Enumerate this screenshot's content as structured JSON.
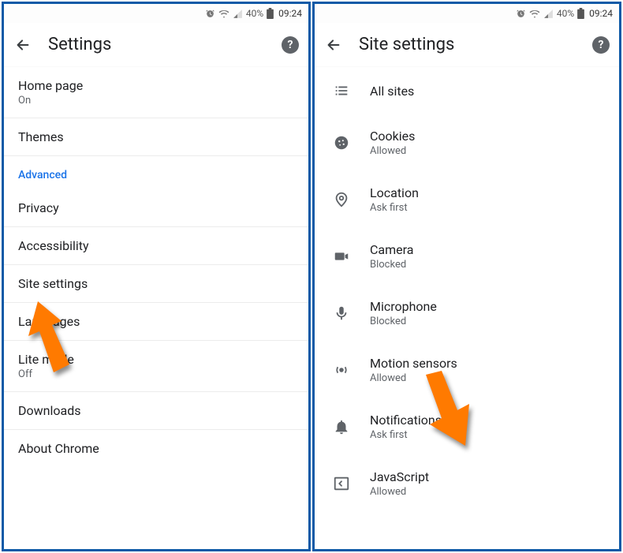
{
  "status": {
    "battery_pct": "40%",
    "time": "09:24"
  },
  "left": {
    "title": "Settings",
    "items": [
      {
        "label": "Home page",
        "sub": "On"
      },
      {
        "label": "Themes",
        "sub": ""
      }
    ],
    "section": "Advanced",
    "advanced_items": [
      {
        "label": "Privacy",
        "sub": ""
      },
      {
        "label": "Accessibility",
        "sub": ""
      },
      {
        "label": "Site settings",
        "sub": ""
      },
      {
        "label": "Languages",
        "sub": ""
      },
      {
        "label": "Lite mode",
        "sub": "Off"
      },
      {
        "label": "Downloads",
        "sub": ""
      },
      {
        "label": "About Chrome",
        "sub": ""
      }
    ]
  },
  "right": {
    "title": "Site settings",
    "items": [
      {
        "icon": "list",
        "label": "All sites",
        "sub": ""
      },
      {
        "icon": "cookie",
        "label": "Cookies",
        "sub": "Allowed"
      },
      {
        "icon": "location",
        "label": "Location",
        "sub": "Ask first"
      },
      {
        "icon": "camera",
        "label": "Camera",
        "sub": "Blocked"
      },
      {
        "icon": "mic",
        "label": "Microphone",
        "sub": "Blocked"
      },
      {
        "icon": "motion",
        "label": "Motion sensors",
        "sub": "Allowed"
      },
      {
        "icon": "bell",
        "label": "Notifications",
        "sub": "Ask first"
      },
      {
        "icon": "js",
        "label": "JavaScript",
        "sub": "Allowed"
      }
    ]
  }
}
